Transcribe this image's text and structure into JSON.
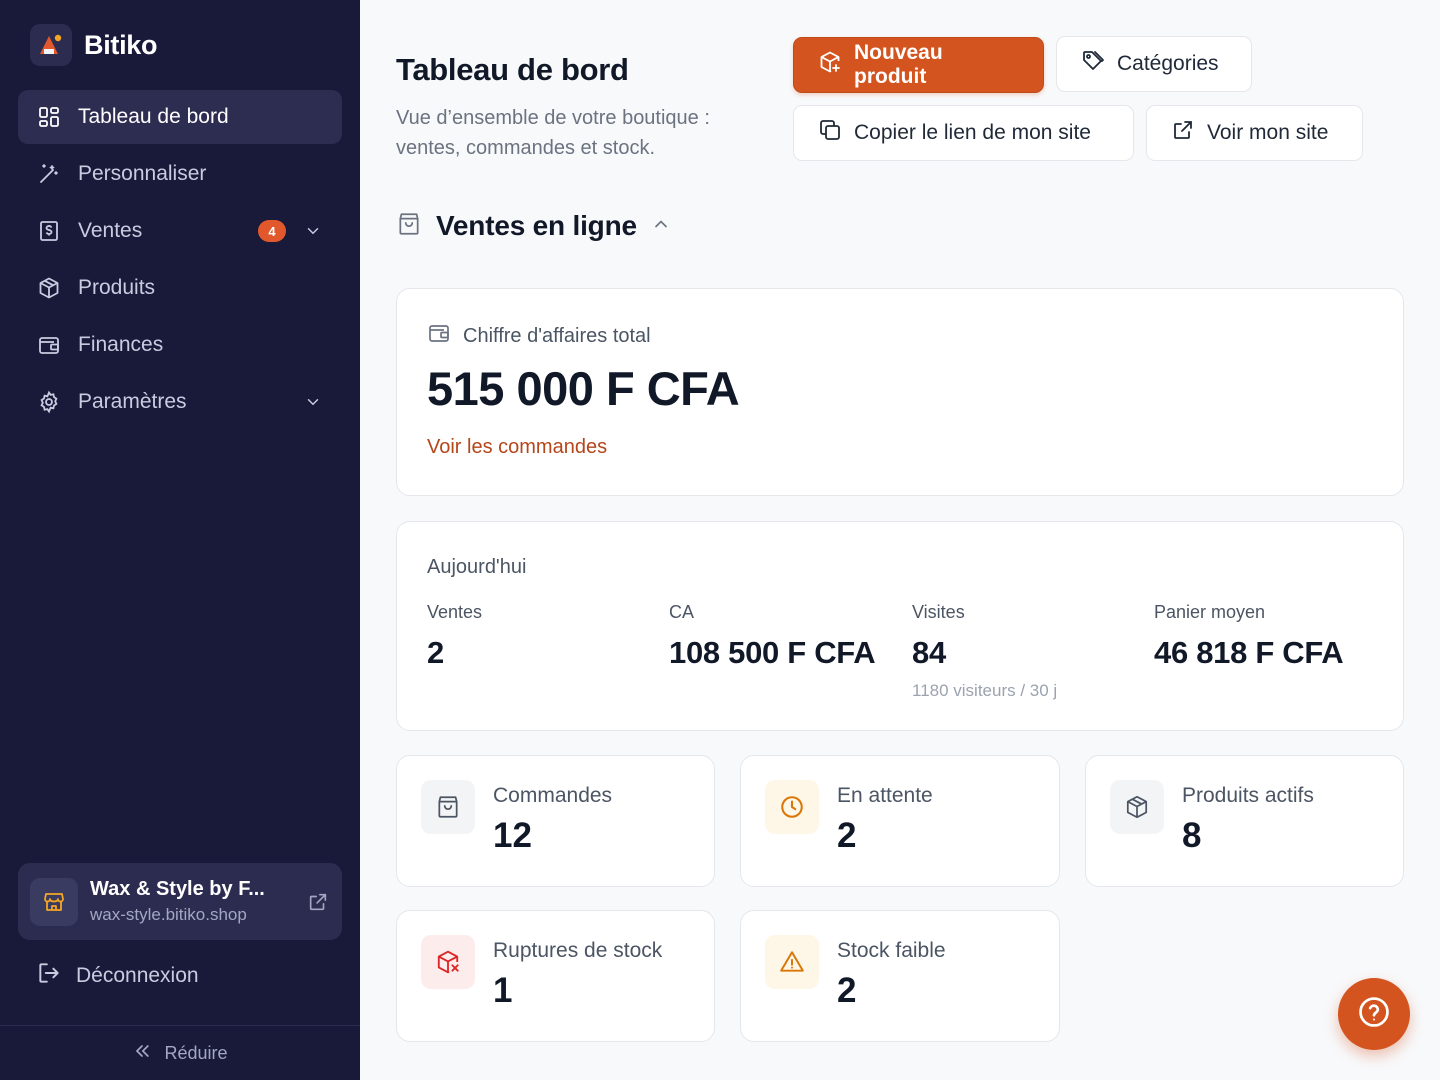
{
  "brand": {
    "name": "Bitiko",
    "accent": "#d4541f"
  },
  "sidebar": {
    "items": [
      {
        "label": "Tableau de bord",
        "icon": "dashboard-icon",
        "active": true
      },
      {
        "label": "Personnaliser",
        "icon": "magic-wand-icon"
      },
      {
        "label": "Ventes",
        "icon": "receipt-icon",
        "badge": "4",
        "expandable": true
      },
      {
        "label": "Produits",
        "icon": "box-icon"
      },
      {
        "label": "Finances",
        "icon": "wallet-icon"
      },
      {
        "label": "Paramètres",
        "icon": "gear-icon",
        "expandable": true
      }
    ],
    "shop": {
      "name": "Wax & Style by F...",
      "url": "wax-style.bitiko.shop"
    },
    "logout_label": "Déconnexion",
    "collapse_label": "Réduire"
  },
  "header": {
    "title": "Tableau de bord",
    "subtitle": "Vue d’ensemble de votre boutique : ventes, commandes et stock.",
    "buttons": {
      "new_product": "Nouveau produit",
      "categories": "Catégories",
      "copy_link": "Copier le lien de mon site",
      "view_site": "Voir mon site"
    }
  },
  "section": {
    "title": "Ventes en ligne"
  },
  "revenue": {
    "label": "Chiffre d'affaires total",
    "amount": "515 000 F CFA",
    "link": "Voir les commandes"
  },
  "today": {
    "title": "Aujourd'hui",
    "stats": [
      {
        "label": "Ventes",
        "value": "2"
      },
      {
        "label": "CA",
        "value": "108 500 F CFA"
      },
      {
        "label": "Visites",
        "value": "84",
        "note": "1180 visiteurs / 30 j"
      },
      {
        "label": "Panier moyen",
        "value": "46 818 F CFA"
      }
    ]
  },
  "kpis": [
    {
      "label": "Commandes",
      "value": "12",
      "icon": "shopping-bag-icon",
      "color": "#4b5563"
    },
    {
      "label": "En attente",
      "value": "2",
      "icon": "clock-icon",
      "color": "#d97706"
    },
    {
      "label": "Produits actifs",
      "value": "8",
      "icon": "box-icon",
      "color": "#4b5563"
    },
    {
      "label": "Ruptures de stock",
      "value": "1",
      "icon": "box-x-icon",
      "color": "#dc2626"
    },
    {
      "label": "Stock faible",
      "value": "2",
      "icon": "warning-icon",
      "color": "#d97706"
    }
  ]
}
